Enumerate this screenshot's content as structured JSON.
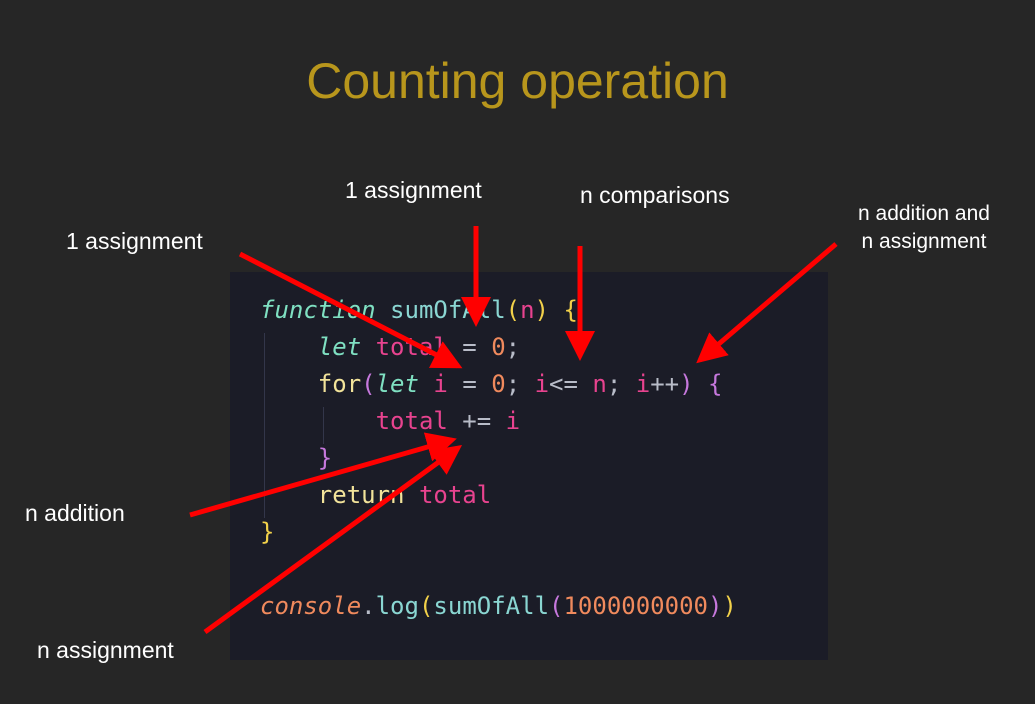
{
  "title": "Counting operation",
  "annotations": [
    {
      "id": "assign-total",
      "text": "1 assignment"
    },
    {
      "id": "assign-i",
      "text": "1 assignment"
    },
    {
      "id": "comparisons",
      "text": "n comparisons"
    },
    {
      "id": "increment",
      "text": "n addition and\nn assignment"
    },
    {
      "id": "addition",
      "text": "n addition"
    },
    {
      "id": "assignment",
      "text": "n assignment"
    }
  ],
  "arrow_color": "#ff0000",
  "code": [
    [
      [
        "kw",
        "function"
      ],
      [
        "op",
        " "
      ],
      [
        "fn",
        "sumOfAll"
      ],
      [
        "p1",
        "("
      ],
      [
        "var",
        "n"
      ],
      [
        "p1",
        ")"
      ],
      [
        "op",
        " "
      ],
      [
        "p1",
        "{"
      ]
    ],
    [
      [
        "op",
        "    "
      ],
      [
        "kw",
        "let"
      ],
      [
        "op",
        " "
      ],
      [
        "var",
        "total"
      ],
      [
        "op",
        " = "
      ],
      [
        "num",
        "0"
      ],
      [
        "op",
        ";"
      ]
    ],
    [
      [
        "op",
        "    "
      ],
      [
        "ctl",
        "for"
      ],
      [
        "p2",
        "("
      ],
      [
        "kw",
        "let"
      ],
      [
        "op",
        " "
      ],
      [
        "var",
        "i"
      ],
      [
        "op",
        " = "
      ],
      [
        "num",
        "0"
      ],
      [
        "op",
        "; "
      ],
      [
        "var",
        "i"
      ],
      [
        "op",
        "<= "
      ],
      [
        "var",
        "n"
      ],
      [
        "op",
        "; "
      ],
      [
        "var",
        "i"
      ],
      [
        "op",
        "++"
      ],
      [
        "p2",
        ")"
      ],
      [
        "op",
        " "
      ],
      [
        "p2",
        "{"
      ]
    ],
    [
      [
        "op",
        "        "
      ],
      [
        "var",
        "total"
      ],
      [
        "op",
        " += "
      ],
      [
        "var",
        "i"
      ]
    ],
    [
      [
        "op",
        "    "
      ],
      [
        "p2",
        "}"
      ]
    ],
    [
      [
        "op",
        "    "
      ],
      [
        "ctl",
        "return"
      ],
      [
        "op",
        " "
      ],
      [
        "var",
        "total"
      ]
    ],
    [
      [
        "p1",
        "}"
      ]
    ],
    [],
    [
      [
        "obj",
        "console"
      ],
      [
        "op",
        "."
      ],
      [
        "fn",
        "log"
      ],
      [
        "p1",
        "("
      ],
      [
        "fn",
        "sumOfAll"
      ],
      [
        "p2",
        "("
      ],
      [
        "num",
        "1000000000"
      ],
      [
        "p2",
        ")"
      ],
      [
        "p1",
        ")"
      ]
    ]
  ]
}
